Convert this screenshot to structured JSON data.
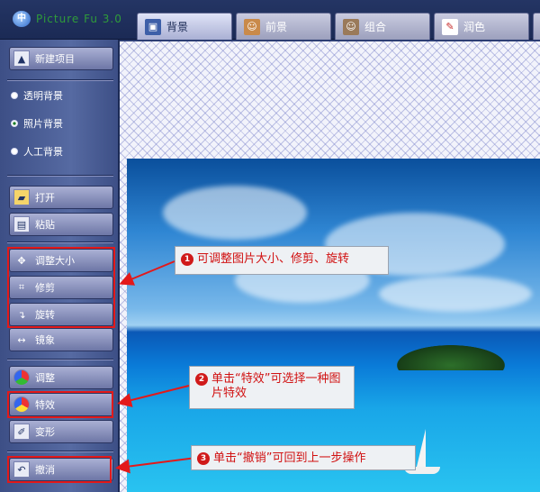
{
  "app": {
    "logo": "中",
    "title": "Picture Fu 3.0"
  },
  "tabs": [
    {
      "label": "背景",
      "icon": "image-icon"
    },
    {
      "label": "前景",
      "icon": "portrait-icon"
    },
    {
      "label": "组合",
      "icon": "compose-icon"
    },
    {
      "label": "润色",
      "icon": "brush-icon"
    }
  ],
  "sidebar": {
    "new_project": "新建项目",
    "bg_options": [
      "透明背景",
      "照片背景",
      "人工背景"
    ],
    "selected_bg": "照片背景",
    "open": "打开",
    "paste": "粘贴",
    "resize": "调整大小",
    "crop": "修剪",
    "rotate": "旋转",
    "mirror": "镜象",
    "adjust": "调整",
    "effects": "特效",
    "transform": "变形",
    "undo": "撤消"
  },
  "callouts": {
    "c1": {
      "num": "1",
      "text": "可调整图片大小、修剪、旋转"
    },
    "c2": {
      "num": "2",
      "text": "单击“特效”可选择一种图片特效"
    },
    "c3": {
      "num": "3",
      "text": "单击“撤销”可回到上一步操作"
    }
  },
  "colors": {
    "highlight": "#e3191a",
    "callout_text": "#d11111",
    "sidebar": "#566aa2"
  }
}
